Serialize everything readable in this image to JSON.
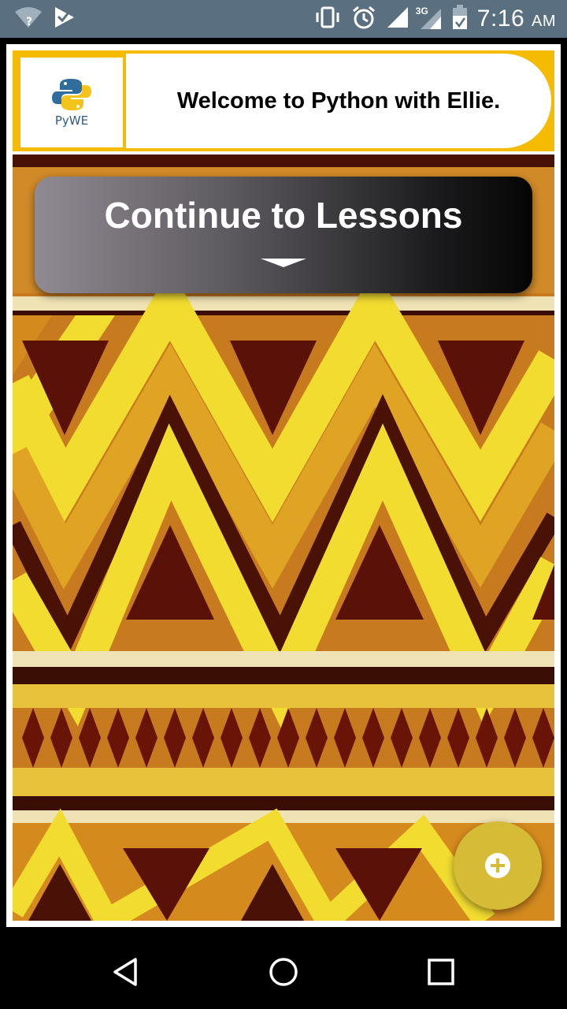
{
  "status_bar": {
    "time": "7:16",
    "ampm": "AM",
    "network_type": "3G",
    "icons": [
      "wifi-unknown-icon",
      "check-flag-icon",
      "vibrate-icon",
      "alarm-icon",
      "signal-icon",
      "signal-3g-icon",
      "battery-icon"
    ]
  },
  "header": {
    "logo_text": "PyWE",
    "welcome": "Welcome to Python with Ellie."
  },
  "continue_card": {
    "label": "Continue to Lessons",
    "icon": "chevron-down-icon"
  },
  "fab": {
    "icon": "add-icon"
  },
  "nav_bar": {
    "icons": [
      "back-icon",
      "home-icon",
      "recents-icon"
    ]
  },
  "colors": {
    "accent": "#f4bb00",
    "fab": "#d6bb36",
    "status_bar": "#5a7080",
    "pattern_orange": "#c87a1e",
    "pattern_yellow": "#f2dc30",
    "pattern_dark": "#5a1208"
  }
}
